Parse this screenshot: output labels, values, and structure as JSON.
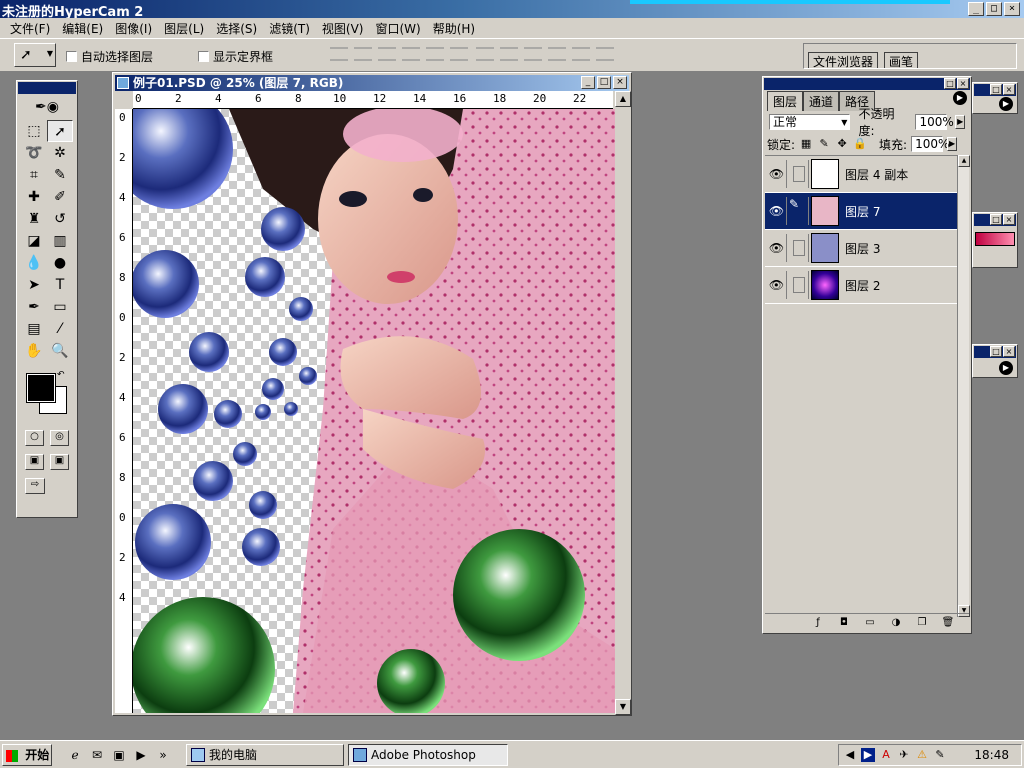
{
  "app": {
    "title": "未注册的HyperCam 2",
    "window_controls": [
      "_",
      "□",
      "×"
    ]
  },
  "menubar": [
    {
      "label": "文件(F)"
    },
    {
      "label": "编辑(E)"
    },
    {
      "label": "图像(I)"
    },
    {
      "label": "图层(L)"
    },
    {
      "label": "选择(S)"
    },
    {
      "label": "滤镜(T)"
    },
    {
      "label": "视图(V)"
    },
    {
      "label": "窗口(W)"
    },
    {
      "label": "帮助(H)"
    }
  ],
  "options": {
    "auto_select_label": "自动选择图层",
    "show_bounds_label": "显示定界框",
    "palette_tabs": [
      "文件浏览器",
      "画笔"
    ]
  },
  "document": {
    "title": "例子01.PSD @ 25% (图层 7, RGB)",
    "ruler_h": [
      "0",
      "2",
      "4",
      "6",
      "8",
      "10",
      "12",
      "14",
      "16",
      "18",
      "20",
      "22"
    ],
    "ruler_v": [
      "0",
      "2",
      "4",
      "6",
      "8",
      "0",
      "2",
      "4",
      "6",
      "8",
      "0",
      "2",
      "4"
    ],
    "zoom": "25%"
  },
  "layers_panel": {
    "tabs": [
      "图层",
      "通道",
      "路径"
    ],
    "blend_mode": "正常",
    "opacity_label": "不透明度:",
    "opacity_value": "100%",
    "lock_label": "锁定:",
    "fill_label": "填充:",
    "fill_value": "100%",
    "layers": [
      {
        "name": "图层 4 副本",
        "visible": true,
        "selected": false
      },
      {
        "name": "图层 7",
        "visible": true,
        "selected": true
      },
      {
        "name": "图层 3",
        "visible": true,
        "selected": false
      },
      {
        "name": "图层 2",
        "visible": true,
        "selected": false
      }
    ]
  },
  "taskbar": {
    "start_label": "开始",
    "tasks": [
      {
        "label": "我的电脑",
        "active": false
      },
      {
        "label": "Adobe Photoshop",
        "active": true
      }
    ],
    "clock": "18:48"
  }
}
